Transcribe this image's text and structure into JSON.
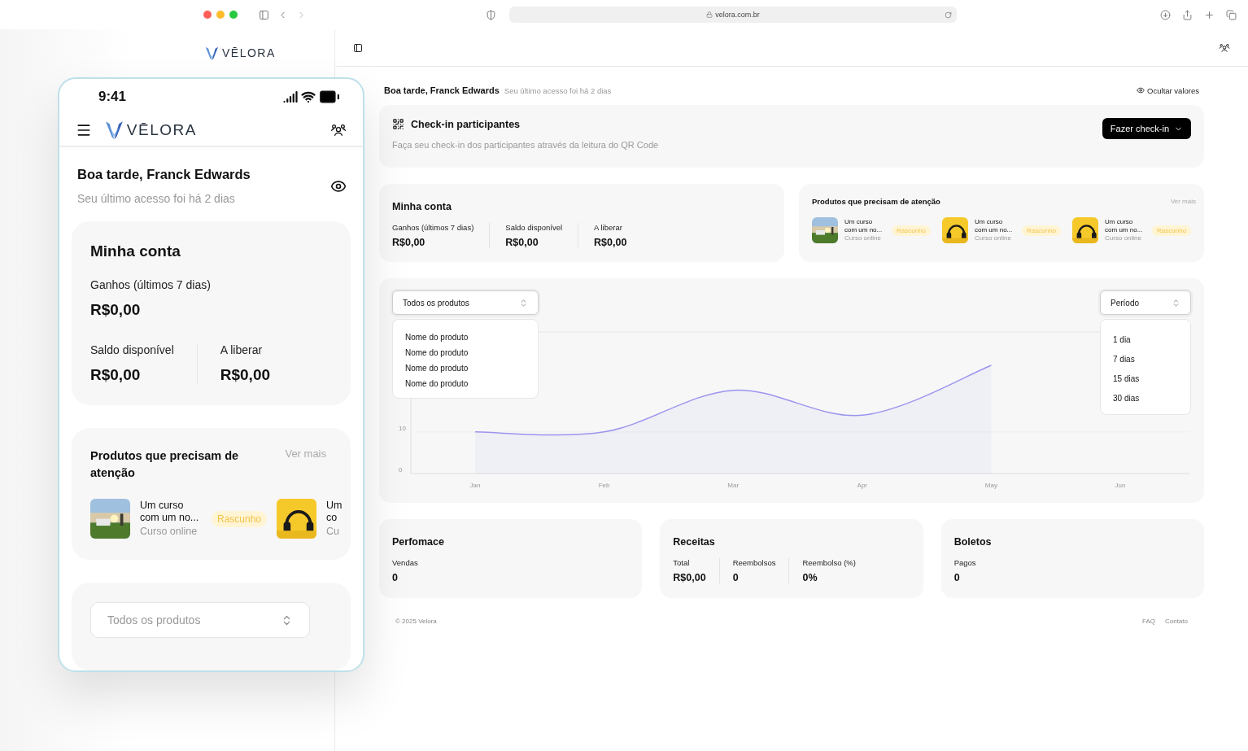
{
  "browser": {
    "url": "velora.com.br"
  },
  "sidebar": {
    "logo": "VĒLORA"
  },
  "greeting": {
    "title": "Boa tarde, Franck Edwards",
    "subtitle": "Seu último acesso foi há 2 dias",
    "hide_values": "Ocultar valores"
  },
  "checkin": {
    "title": "Check-in participantes",
    "description": "Faça seu check-in dos participantes através da leitura do QR Code",
    "button": "Fazer check-in"
  },
  "account": {
    "title": "Minha conta",
    "stats": [
      {
        "label": "Ganhos (últimos 7 dias)",
        "value": "R$0,00"
      },
      {
        "label": "Saldo disponível",
        "value": "R$0,00"
      },
      {
        "label": "A liberar",
        "value": "R$0,00"
      }
    ]
  },
  "attention": {
    "title": "Produtos que precisam de atenção",
    "more": "Ver mais",
    "products": [
      {
        "title": "Um curso com um no...",
        "subtitle": "Curso online",
        "badge": "Rascunho"
      },
      {
        "title": "Um curso com um no...",
        "subtitle": "Curso online",
        "badge": "Rascunho"
      },
      {
        "title": "Um curso com um no...",
        "subtitle": "Curso online",
        "badge": "Rascunho"
      }
    ]
  },
  "chart_panel": {
    "product_select": {
      "value": "Todos os produtos",
      "open": true,
      "options": [
        "Nome do produto",
        "Nome do produto",
        "Nome do produto",
        "Nome do produto"
      ]
    },
    "period_select": {
      "value": "Período",
      "open": true,
      "options": [
        "1 dia",
        "7 dias",
        "15 dias",
        "30 dias"
      ]
    },
    "chart_data": {
      "type": "area",
      "categories": [
        "Jan",
        "Feb",
        "Mar",
        "Apr",
        "May",
        "Jun"
      ],
      "series": [
        {
          "color": "#9b95ee",
          "values": [
            10,
            10,
            20,
            14,
            26,
            null
          ]
        }
      ],
      "ylim": [
        0,
        34
      ],
      "yticks": [
        0,
        10
      ]
    }
  },
  "cards": [
    {
      "title": "Perfomace",
      "stats": [
        {
          "label": "Vendas",
          "value": "0"
        }
      ]
    },
    {
      "title": "Receitas",
      "stats": [
        {
          "label": "Total",
          "value": "R$0,00"
        },
        {
          "label": "Reembolsos",
          "value": "0"
        },
        {
          "label": "Reembolso (%)",
          "value": "0%"
        }
      ]
    },
    {
      "title": "Boletos",
      "stats": [
        {
          "label": "Pagos",
          "value": "0"
        }
      ]
    }
  ],
  "footer": {
    "copyright": "© 2025 Velora",
    "links": [
      "FAQ",
      "Contato"
    ]
  },
  "phone": {
    "time": "9:41",
    "logo": "VĒLORA",
    "greeting": "Boa tarde, Franck Edwards",
    "subtitle": "Seu último acesso foi há 2 dias",
    "account": {
      "title": "Minha conta",
      "main": {
        "label": "Ganhos (últimos 7 dias)",
        "value": "R$0,00"
      },
      "stats": [
        {
          "label": "Saldo disponível",
          "value": "R$0,00"
        },
        {
          "label": "A liberar",
          "value": "R$0,00"
        }
      ]
    },
    "attention": {
      "title": "Produtos que precisam de atenção",
      "more": "Ver mais",
      "products": [
        {
          "title": "Um curso com um no...",
          "subtitle": "Curso online",
          "badge": "Rascunho"
        },
        {
          "title": "Um co",
          "subtitle": "Cu"
        }
      ]
    },
    "select": {
      "placeholder": "Todos os produtos"
    }
  }
}
